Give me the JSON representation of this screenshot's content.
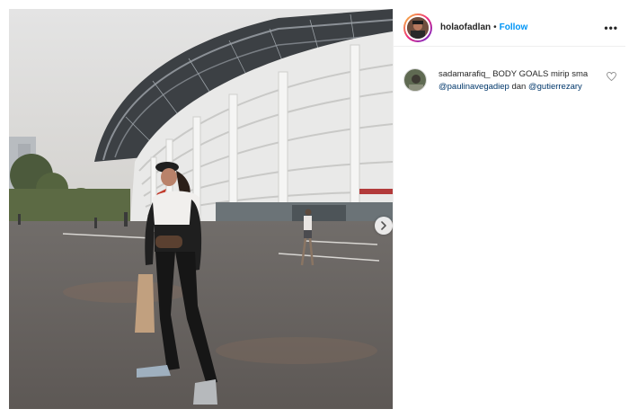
{
  "post": {
    "username": "holaofadlan",
    "separator": "•",
    "follow_label": "Follow",
    "more_label": "•••",
    "icons": {
      "next": "chevron-right-icon",
      "more": "more-options-icon",
      "like": "heart-icon"
    }
  },
  "comment": {
    "username": "sadamarafiq_",
    "text_1": "BODY GOALS mirip sma",
    "mention_1": "@paulinavegadiep",
    "text_2": "dan",
    "mention_2": "@gutierrezary"
  },
  "colors": {
    "follow_blue": "#0095f6",
    "mention_blue": "#00376b",
    "text": "#262626"
  }
}
